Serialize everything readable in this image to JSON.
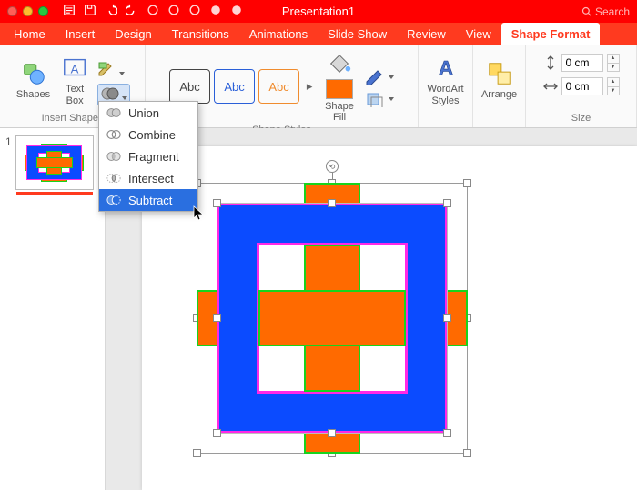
{
  "title": "Presentation1",
  "search_placeholder": "Search",
  "tabs": {
    "items": [
      "Home",
      "Insert",
      "Design",
      "Transitions",
      "Animations",
      "Slide Show",
      "Review",
      "View",
      "Shape Format"
    ],
    "active": "Shape Format"
  },
  "ribbon": {
    "insert_shapes": {
      "shapes_label": "Shapes",
      "textbox_label": "Text\nBox",
      "group_label": "Insert Shapes"
    },
    "shape_styles": {
      "swatch_text": "Abc",
      "fill_label": "Shape\nFill",
      "group_label": "Shape Styles"
    },
    "wordart_label": "WordArt\nStyles",
    "arrange_label": "Arrange",
    "size": {
      "height": "0 cm",
      "width": "0 cm",
      "group_label": "Size"
    }
  },
  "merge_menu": {
    "items": [
      {
        "label": "Union"
      },
      {
        "label": "Combine"
      },
      {
        "label": "Fragment"
      },
      {
        "label": "Intersect"
      },
      {
        "label": "Subtract"
      }
    ],
    "hover_index": 4
  },
  "slides": {
    "current": "1"
  }
}
